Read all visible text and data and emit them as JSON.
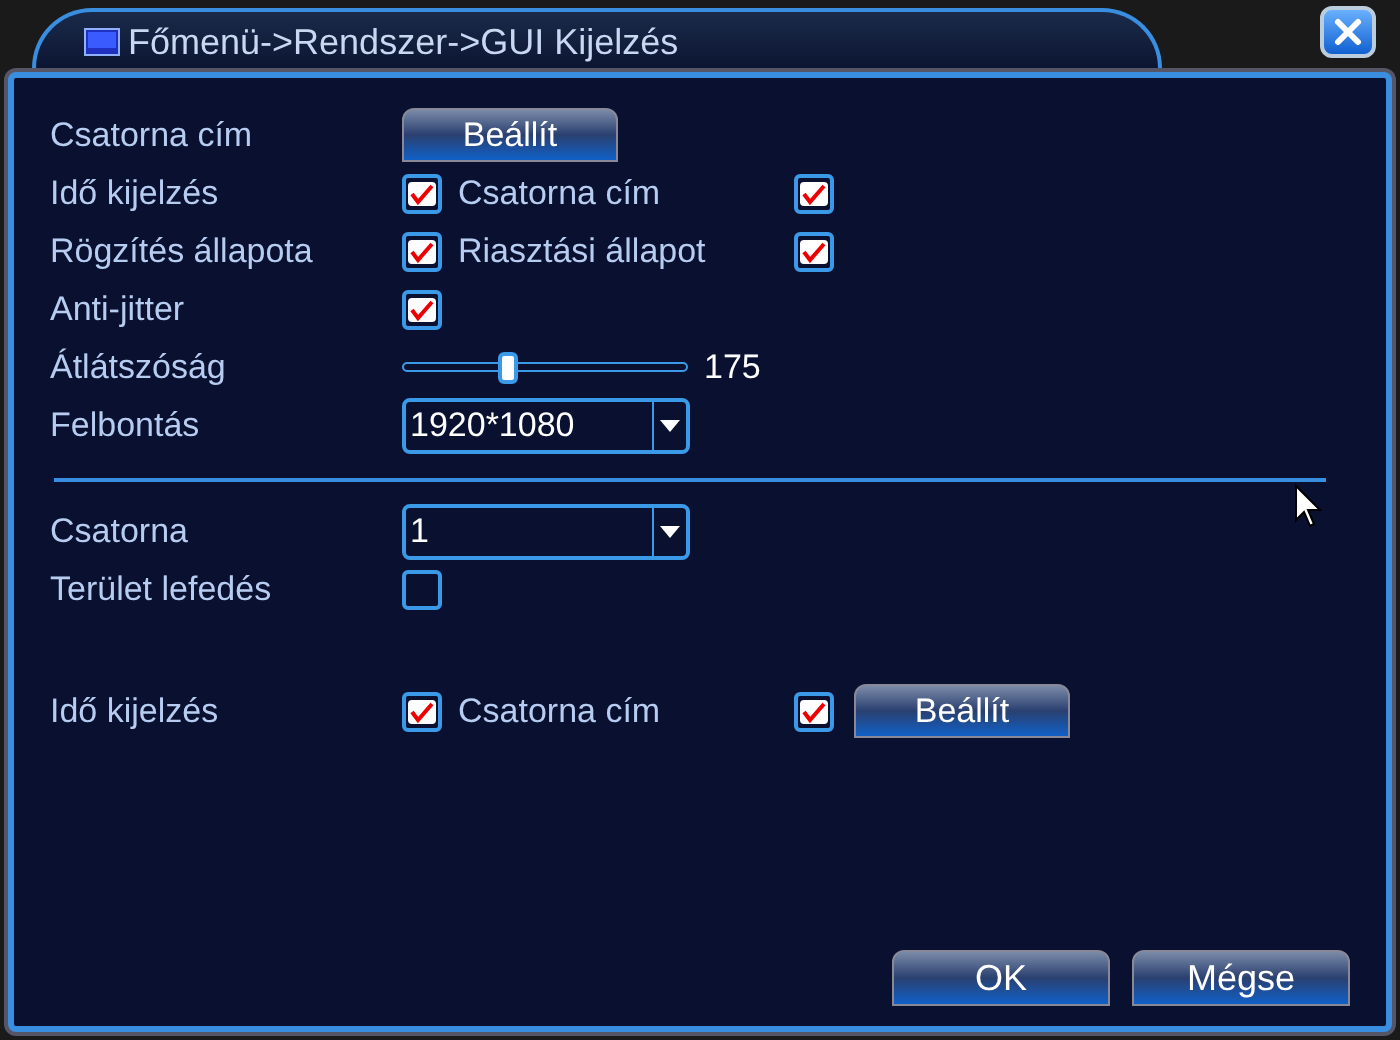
{
  "window": {
    "title": "Főmenü->Rendszer->GUI Kijelzés"
  },
  "sections": [
    {
      "rows": [
        {
          "kind": "button",
          "label": "Csatorna cím",
          "button": "Beállít"
        },
        {
          "kind": "checks",
          "items": [
            {
              "label": "Idő kijelzés",
              "checked": true
            },
            {
              "label": "Csatorna cím",
              "checked": true
            }
          ]
        },
        {
          "kind": "checks",
          "items": [
            {
              "label": "Rögzítés állapota",
              "checked": true
            },
            {
              "label": "Riasztási állapot",
              "checked": true
            }
          ]
        },
        {
          "kind": "checks",
          "items": [
            {
              "label": "Anti-jitter",
              "checked": true
            }
          ]
        },
        {
          "kind": "slider",
          "label": "Átlátszóság",
          "level": 0.38,
          "reading": "175"
        },
        {
          "kind": "dropdown",
          "label": "Felbontás",
          "value": "1920*1080"
        }
      ]
    },
    {
      "rows": [
        {
          "kind": "dropdown",
          "label": "Csatorna",
          "value": "1"
        },
        {
          "kind": "checks",
          "items": [
            {
              "label": "Terület lefedés",
              "checked": false
            }
          ]
        },
        {
          "kind": "checks",
          "items": [
            {
              "label": "Idő kijelzés",
              "checked": true
            },
            {
              "label": "Csatorna cím",
              "checked": true
            }
          ],
          "button": "Beállít"
        }
      ]
    }
  ],
  "buttons": [
    "OK",
    "Mégse"
  ]
}
